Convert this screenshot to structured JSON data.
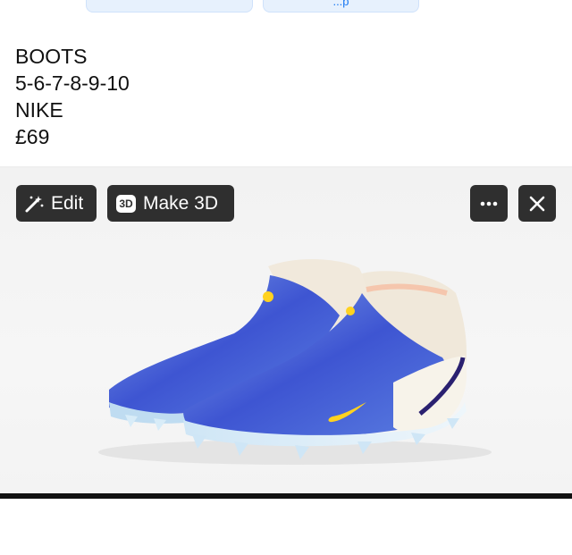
{
  "top_buttons": {
    "left_label": "",
    "right_label": "...p"
  },
  "listing": {
    "title": "BOOTS",
    "sizes": "5-6-7-8-9-10",
    "brand": "NIKE",
    "price": "£69"
  },
  "toolbar": {
    "edit_label": "Edit",
    "make3d_label": "Make 3D",
    "make3d_badge": "3D"
  },
  "icons": {
    "edit": "magic-wand-icon",
    "make3d": "3d-badge-icon",
    "more": "ellipsis-icon",
    "close": "close-icon"
  },
  "colors": {
    "button_bg": "#2f2f2f",
    "button_text": "#ffffff",
    "photo_bg": "#f3f3f3",
    "link_blue": "#1877f2"
  }
}
